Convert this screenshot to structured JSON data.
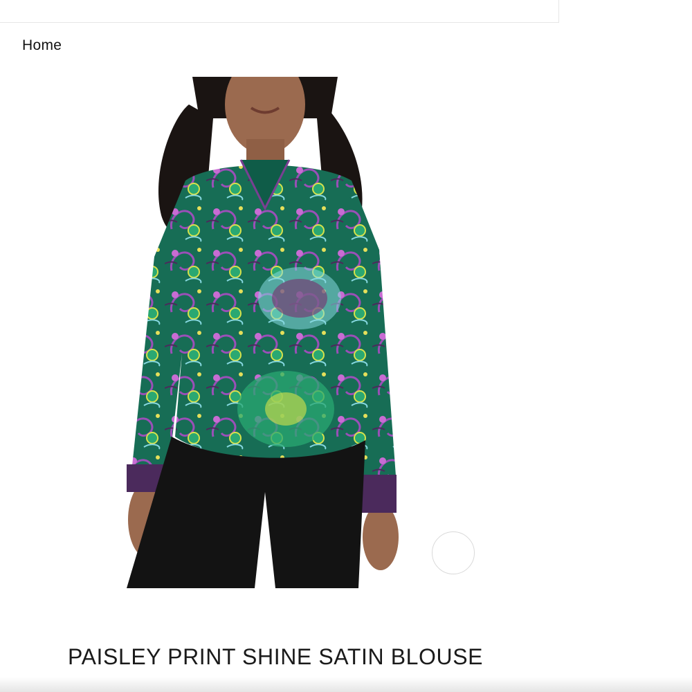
{
  "breadcrumb": {
    "home_label": "Home"
  },
  "product": {
    "title": "PAISLEY PRINT SHINE SATIN BLOUSE",
    "image_alt": "model-wearing-paisley-blouse"
  },
  "colors": {
    "text": "#111111",
    "blouse_green": "#1e8a5e",
    "blouse_teal": "#0f6b5a",
    "blouse_purple": "#9b4fb8",
    "pants_black": "#131313"
  },
  "icons": {
    "carousel_dot": "circle-outline-icon"
  }
}
